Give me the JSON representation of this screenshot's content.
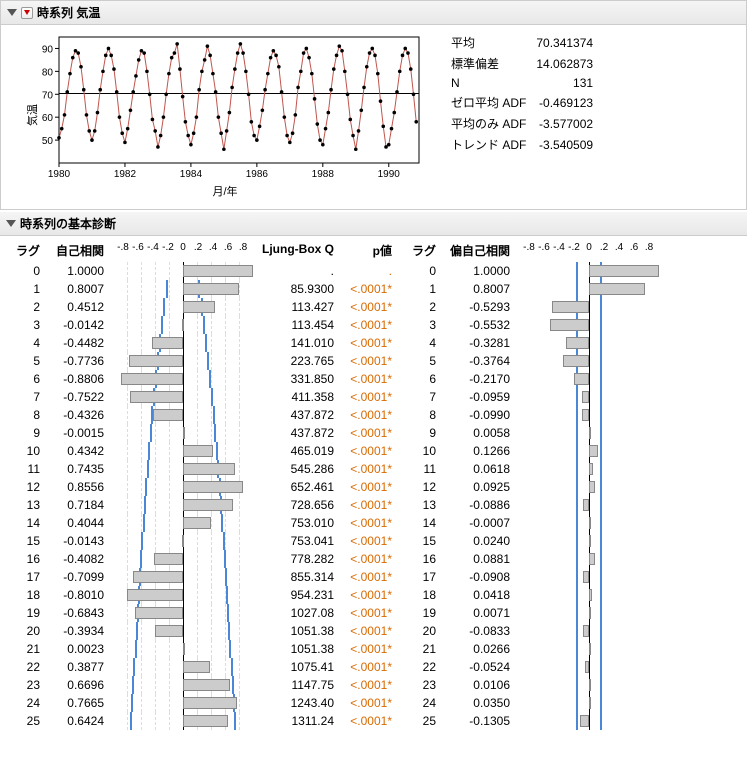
{
  "sections": {
    "main_title": "時系列 気温",
    "diag_title": "時系列の基本診断"
  },
  "stats": [
    {
      "label": "平均",
      "value": "70.341374"
    },
    {
      "label": "標準偏差",
      "value": "14.062873"
    },
    {
      "label": "N",
      "value": "131"
    },
    {
      "label": "ゼロ平均 ADF",
      "value": "-0.469123"
    },
    {
      "label": "平均のみ ADF",
      "value": "-3.577002"
    },
    {
      "label": "トレンド ADF",
      "value": "-3.540509"
    }
  ],
  "diag_headers": {
    "lag": "ラグ",
    "acf": "自己相関",
    "q": "Ljung-Box Q",
    "p": "p値",
    "lag2": "ラグ",
    "pacf": "偏自己相関",
    "ticks": [
      "-.8",
      "-.6",
      "-.4",
      "-.2",
      "0",
      ".2",
      ".4",
      ".6",
      ".8"
    ]
  },
  "acf_rows": [
    {
      "lag": 0,
      "acf": "1.0000",
      "q": ".",
      "p": ".",
      "pacf": "1.0000"
    },
    {
      "lag": 1,
      "acf": "0.8007",
      "q": "85.9300",
      "p": "<.0001*",
      "pacf": "0.8007"
    },
    {
      "lag": 2,
      "acf": "0.4512",
      "q": "113.427",
      "p": "<.0001*",
      "pacf": "-0.5293"
    },
    {
      "lag": 3,
      "acf": "-0.0142",
      "q": "113.454",
      "p": "<.0001*",
      "pacf": "-0.5532"
    },
    {
      "lag": 4,
      "acf": "-0.4482",
      "q": "141.010",
      "p": "<.0001*",
      "pacf": "-0.3281"
    },
    {
      "lag": 5,
      "acf": "-0.7736",
      "q": "223.765",
      "p": "<.0001*",
      "pacf": "-0.3764"
    },
    {
      "lag": 6,
      "acf": "-0.8806",
      "q": "331.850",
      "p": "<.0001*",
      "pacf": "-0.2170"
    },
    {
      "lag": 7,
      "acf": "-0.7522",
      "q": "411.358",
      "p": "<.0001*",
      "pacf": "-0.0959"
    },
    {
      "lag": 8,
      "acf": "-0.4326",
      "q": "437.872",
      "p": "<.0001*",
      "pacf": "-0.0990"
    },
    {
      "lag": 9,
      "acf": "-0.0015",
      "q": "437.872",
      "p": "<.0001*",
      "pacf": "0.0058"
    },
    {
      "lag": 10,
      "acf": "0.4342",
      "q": "465.019",
      "p": "<.0001*",
      "pacf": "0.1266"
    },
    {
      "lag": 11,
      "acf": "0.7435",
      "q": "545.286",
      "p": "<.0001*",
      "pacf": "0.0618"
    },
    {
      "lag": 12,
      "acf": "0.8556",
      "q": "652.461",
      "p": "<.0001*",
      "pacf": "0.0925"
    },
    {
      "lag": 13,
      "acf": "0.7184",
      "q": "728.656",
      "p": "<.0001*",
      "pacf": "-0.0886"
    },
    {
      "lag": 14,
      "acf": "0.4044",
      "q": "753.010",
      "p": "<.0001*",
      "pacf": "-0.0007"
    },
    {
      "lag": 15,
      "acf": "-0.0143",
      "q": "753.041",
      "p": "<.0001*",
      "pacf": "0.0240"
    },
    {
      "lag": 16,
      "acf": "-0.4082",
      "q": "778.282",
      "p": "<.0001*",
      "pacf": "0.0881"
    },
    {
      "lag": 17,
      "acf": "-0.7099",
      "q": "855.314",
      "p": "<.0001*",
      "pacf": "-0.0908"
    },
    {
      "lag": 18,
      "acf": "-0.8010",
      "q": "954.231",
      "p": "<.0001*",
      "pacf": "0.0418"
    },
    {
      "lag": 19,
      "acf": "-0.6843",
      "q": "1027.08",
      "p": "<.0001*",
      "pacf": "0.0071"
    },
    {
      "lag": 20,
      "acf": "-0.3934",
      "q": "1051.38",
      "p": "<.0001*",
      "pacf": "-0.0833"
    },
    {
      "lag": 21,
      "acf": "0.0023",
      "q": "1051.38",
      "p": "<.0001*",
      "pacf": "0.0266"
    },
    {
      "lag": 22,
      "acf": "0.3877",
      "q": "1075.41",
      "p": "<.0001*",
      "pacf": "-0.0524"
    },
    {
      "lag": 23,
      "acf": "0.6696",
      "q": "1147.75",
      "p": "<.0001*",
      "pacf": "0.0106"
    },
    {
      "lag": 24,
      "acf": "0.7665",
      "q": "1243.40",
      "p": "<.0001*",
      "pacf": "0.0350"
    },
    {
      "lag": 25,
      "acf": "0.6424",
      "q": "1311.24",
      "p": "<.0001*",
      "pacf": "-0.1305"
    }
  ],
  "chart_data": {
    "type": "line",
    "title": "",
    "xlabel": "月/年",
    "ylabel": "気温",
    "xlim": [
      1980.0,
      1990.917
    ],
    "ylim": [
      40,
      95
    ],
    "xticks": [
      1980,
      1982,
      1984,
      1986,
      1988,
      1990
    ],
    "yticks": [
      50,
      60,
      70,
      80,
      90
    ],
    "mean_ref": 70.341374,
    "x": [
      1980.0,
      1980.083,
      1980.167,
      1980.25,
      1980.333,
      1980.417,
      1980.5,
      1980.583,
      1980.667,
      1980.75,
      1980.833,
      1980.917,
      1981.0,
      1981.083,
      1981.167,
      1981.25,
      1981.333,
      1981.417,
      1981.5,
      1981.583,
      1981.667,
      1981.75,
      1981.833,
      1981.917,
      1982.0,
      1982.083,
      1982.167,
      1982.25,
      1982.333,
      1982.417,
      1982.5,
      1982.583,
      1982.667,
      1982.75,
      1982.833,
      1982.917,
      1983.0,
      1983.083,
      1983.167,
      1983.25,
      1983.333,
      1983.417,
      1983.5,
      1983.583,
      1983.667,
      1983.75,
      1983.833,
      1983.917,
      1984.0,
      1984.083,
      1984.167,
      1984.25,
      1984.333,
      1984.417,
      1984.5,
      1984.583,
      1984.667,
      1984.75,
      1984.833,
      1984.917,
      1985.0,
      1985.083,
      1985.167,
      1985.25,
      1985.333,
      1985.417,
      1985.5,
      1985.583,
      1985.667,
      1985.75,
      1985.833,
      1985.917,
      1986.0,
      1986.083,
      1986.167,
      1986.25,
      1986.333,
      1986.417,
      1986.5,
      1986.583,
      1986.667,
      1986.75,
      1986.833,
      1986.917,
      1987.0,
      1987.083,
      1987.167,
      1987.25,
      1987.333,
      1987.417,
      1987.5,
      1987.583,
      1987.667,
      1987.75,
      1987.833,
      1987.917,
      1988.0,
      1988.083,
      1988.167,
      1988.25,
      1988.333,
      1988.417,
      1988.5,
      1988.583,
      1988.667,
      1988.75,
      1988.833,
      1988.917,
      1989.0,
      1989.083,
      1989.167,
      1989.25,
      1989.333,
      1989.417,
      1989.5,
      1989.583,
      1989.667,
      1989.75,
      1989.833,
      1989.917,
      1990.0,
      1990.083,
      1990.167,
      1990.25,
      1990.333,
      1990.417,
      1990.5,
      1990.583,
      1990.667,
      1990.75,
      1990.833
    ],
    "y": [
      51,
      55,
      61,
      71,
      79,
      86,
      89,
      88,
      82,
      72,
      61,
      54,
      50,
      54,
      62,
      72,
      80,
      87,
      90,
      87,
      81,
      71,
      60,
      53,
      49,
      55,
      63,
      71,
      78,
      85,
      89,
      88,
      80,
      70,
      59,
      54,
      47,
      52,
      60,
      70,
      79,
      86,
      88,
      92,
      81,
      69,
      58,
      52,
      48,
      53,
      60,
      72,
      80,
      85,
      91,
      87,
      79,
      71,
      60,
      53,
      46,
      54,
      62,
      73,
      81,
      88,
      92,
      88,
      80,
      70,
      58,
      52,
      50,
      56,
      63,
      72,
      79,
      86,
      89,
      87,
      82,
      71,
      60,
      52,
      49,
      53,
      61,
      73,
      80,
      88,
      90,
      86,
      79,
      68,
      57,
      50,
      48,
      55,
      62,
      72,
      81,
      87,
      91,
      89,
      80,
      70,
      59,
      52,
      46,
      54,
      63,
      73,
      82,
      88,
      90,
      87,
      79,
      67,
      56,
      47,
      48,
      55,
      62,
      71,
      80,
      87,
      90,
      88,
      81,
      70,
      58
    ]
  }
}
